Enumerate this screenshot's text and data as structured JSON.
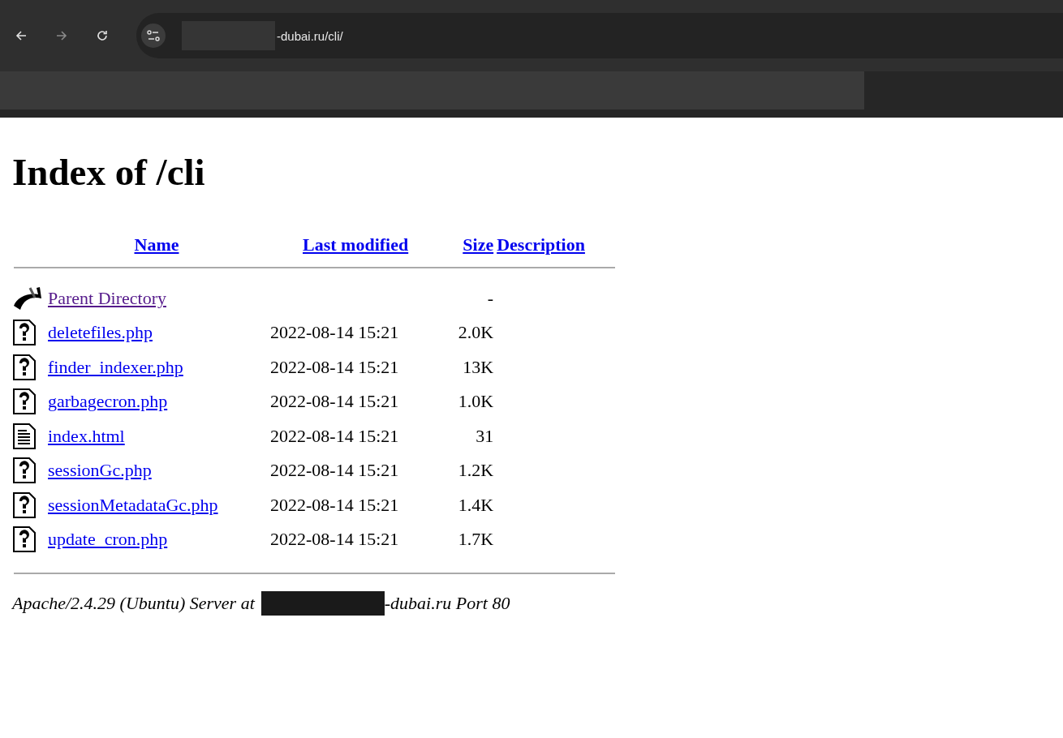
{
  "browser": {
    "nav_buttons": [
      {
        "kind": "back",
        "disabled": false
      },
      {
        "kind": "forward",
        "disabled": true
      },
      {
        "kind": "reload",
        "disabled": false
      }
    ],
    "address": "-dubai.ru/cli/"
  },
  "page": {
    "title": "Index of /cli",
    "columns": [
      "Name",
      "Last modified",
      "Size",
      "Description"
    ],
    "rows": [
      {
        "kind": "parent",
        "name": "Parent Directory",
        "visited": true,
        "modified": "",
        "size": "-"
      },
      {
        "kind": "unknown",
        "name": "deletefiles.php",
        "visited": false,
        "modified": "2022-08-14 15:21",
        "size": "2.0K"
      },
      {
        "kind": "unknown",
        "name": "finder_indexer.php",
        "visited": false,
        "modified": "2022-08-14 15:21",
        "size": "13K"
      },
      {
        "kind": "unknown",
        "name": "garbagecron.php",
        "visited": false,
        "modified": "2022-08-14 15:21",
        "size": "1.0K"
      },
      {
        "kind": "text",
        "name": "index.html",
        "visited": false,
        "modified": "2022-08-14 15:21",
        "size": "31"
      },
      {
        "kind": "unknown",
        "name": "sessionGc.php",
        "visited": false,
        "modified": "2022-08-14 15:21",
        "size": "1.2K"
      },
      {
        "kind": "unknown",
        "name": "sessionMetadataGc.php",
        "visited": false,
        "modified": "2022-08-14 15:21",
        "size": "1.4K"
      },
      {
        "kind": "unknown",
        "name": "update_cron.php",
        "visited": false,
        "modified": "2022-08-14 15:21",
        "size": "1.7K"
      }
    ],
    "footer": {
      "before": "Apache/2.4.29 (Ubuntu) Server at",
      "after": "-dubai.ru Port 80"
    }
  }
}
